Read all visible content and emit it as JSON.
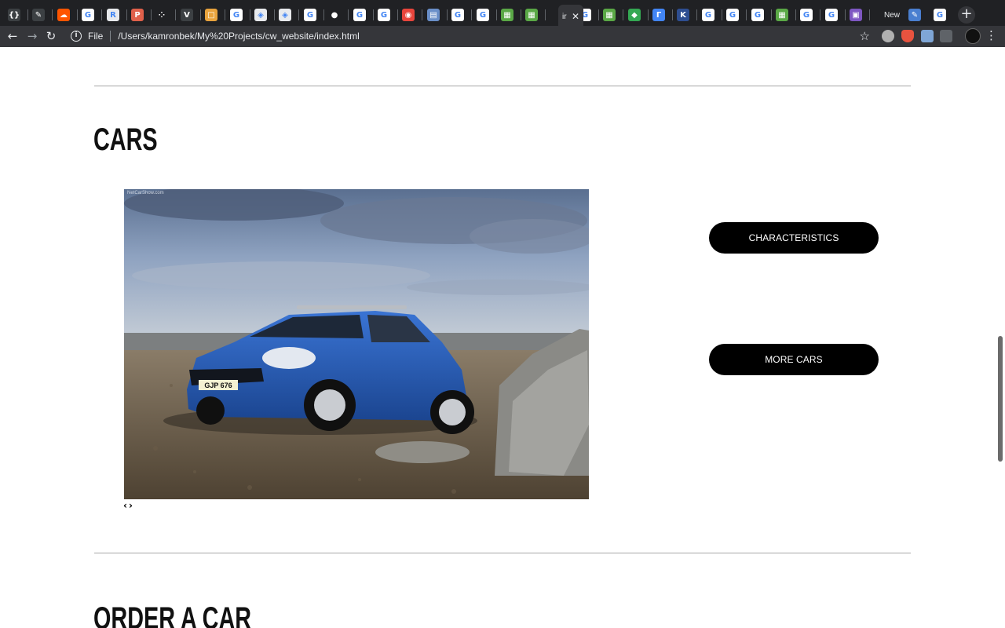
{
  "browser": {
    "tabs": [
      {
        "icon": "brackets-icon",
        "color": "#3c4043",
        "glyph": "{}"
      },
      {
        "icon": "script-icon",
        "color": "#3c4043",
        "glyph": "✎"
      },
      {
        "icon": "soundcloud-icon",
        "color": "#ff5500",
        "glyph": "☁"
      },
      {
        "icon": "google-icon",
        "color": "#ffffff",
        "glyph": "G"
      },
      {
        "icon": "r-app-icon",
        "color": "#e8eaed",
        "glyph": "R"
      },
      {
        "icon": "p-app-icon",
        "color": "#e0604a",
        "glyph": "P"
      },
      {
        "icon": "grid-app-icon",
        "color": "#202124",
        "glyph": "⁘"
      },
      {
        "icon": "v-app-icon",
        "color": "#3c4043",
        "glyph": "V"
      },
      {
        "icon": "square-app-icon",
        "color": "#e8a33d",
        "glyph": "□"
      },
      {
        "icon": "google-icon",
        "color": "#ffffff",
        "glyph": "G"
      },
      {
        "icon": "cube-app-icon",
        "color": "#e8eaed",
        "glyph": "◈"
      },
      {
        "icon": "cube-app-icon",
        "color": "#e8eaed",
        "glyph": "◈"
      },
      {
        "icon": "google-icon",
        "color": "#ffffff",
        "glyph": "G"
      },
      {
        "icon": "github-icon",
        "color": "#202124",
        "glyph": "●"
      },
      {
        "icon": "google-icon",
        "color": "#ffffff",
        "glyph": "G"
      },
      {
        "icon": "google-icon",
        "color": "#ffffff",
        "glyph": "G"
      },
      {
        "icon": "red-app-icon",
        "color": "#e8453c",
        "glyph": "◉"
      },
      {
        "icon": "chart-app-icon",
        "color": "#6a8fc8",
        "glyph": "▤"
      },
      {
        "icon": "google-icon",
        "color": "#ffffff",
        "glyph": "G"
      },
      {
        "icon": "google-icon",
        "color": "#ffffff",
        "glyph": "G"
      },
      {
        "icon": "sheet-app-icon",
        "color": "#5aa846",
        "glyph": "▦"
      },
      {
        "icon": "sheet-app-icon",
        "color": "#5aa846",
        "glyph": "▦"
      },
      {
        "icon": "google-icon",
        "color": "#ffffff",
        "glyph": "G"
      },
      {
        "icon": "sheet-app-icon",
        "color": "#5aa846",
        "glyph": "▦"
      },
      {
        "icon": "maps-icon",
        "color": "#34a853",
        "glyph": "◆"
      },
      {
        "icon": "blue-app-icon",
        "color": "#4285f4",
        "glyph": "Г"
      },
      {
        "icon": "k-app-icon",
        "color": "#2e4e91",
        "glyph": "K"
      },
      {
        "icon": "google-icon",
        "color": "#ffffff",
        "glyph": "G"
      },
      {
        "icon": "google-icon",
        "color": "#ffffff",
        "glyph": "G"
      },
      {
        "icon": "google-icon",
        "color": "#ffffff",
        "glyph": "G"
      },
      {
        "icon": "sheet-app-icon",
        "color": "#5aa846",
        "glyph": "▦"
      },
      {
        "icon": "google-icon",
        "color": "#ffffff",
        "glyph": "G"
      },
      {
        "icon": "google-icon",
        "color": "#ffffff",
        "glyph": "G"
      },
      {
        "icon": "purple-app-icon",
        "color": "#7e57c2",
        "glyph": "▣"
      }
    ],
    "active_tab": {
      "label": "ir",
      "close": "✕"
    },
    "newtab_tab": {
      "label": "New"
    },
    "tail_tabs": [
      {
        "icon": "blue-app-icon",
        "color": "#4a7fd0",
        "glyph": "✎"
      },
      {
        "icon": "google-icon",
        "color": "#ffffff",
        "glyph": "G"
      }
    ],
    "new_tab_button": "+",
    "back": "←",
    "forward": "→",
    "reload": "↻",
    "info_icon": "i",
    "scheme": "File",
    "url": "/Users/kamronbek/My%20Projects/cw_website/index.html",
    "star": "☆",
    "menu": "⋮"
  },
  "page": {
    "cars_section": {
      "title": "CARS",
      "watermark": "NetCarShow.com",
      "plate": "GJP 676",
      "prev_arrow": "‹",
      "next_arrow": "›",
      "characteristics_button": "CHARACTERISTICS",
      "more_cars_button": "MORE CARS"
    },
    "order_section": {
      "title": "ORDER A CAR"
    }
  },
  "colors": {
    "accent_button": "#000000",
    "car_body": "#2a5fb8"
  }
}
